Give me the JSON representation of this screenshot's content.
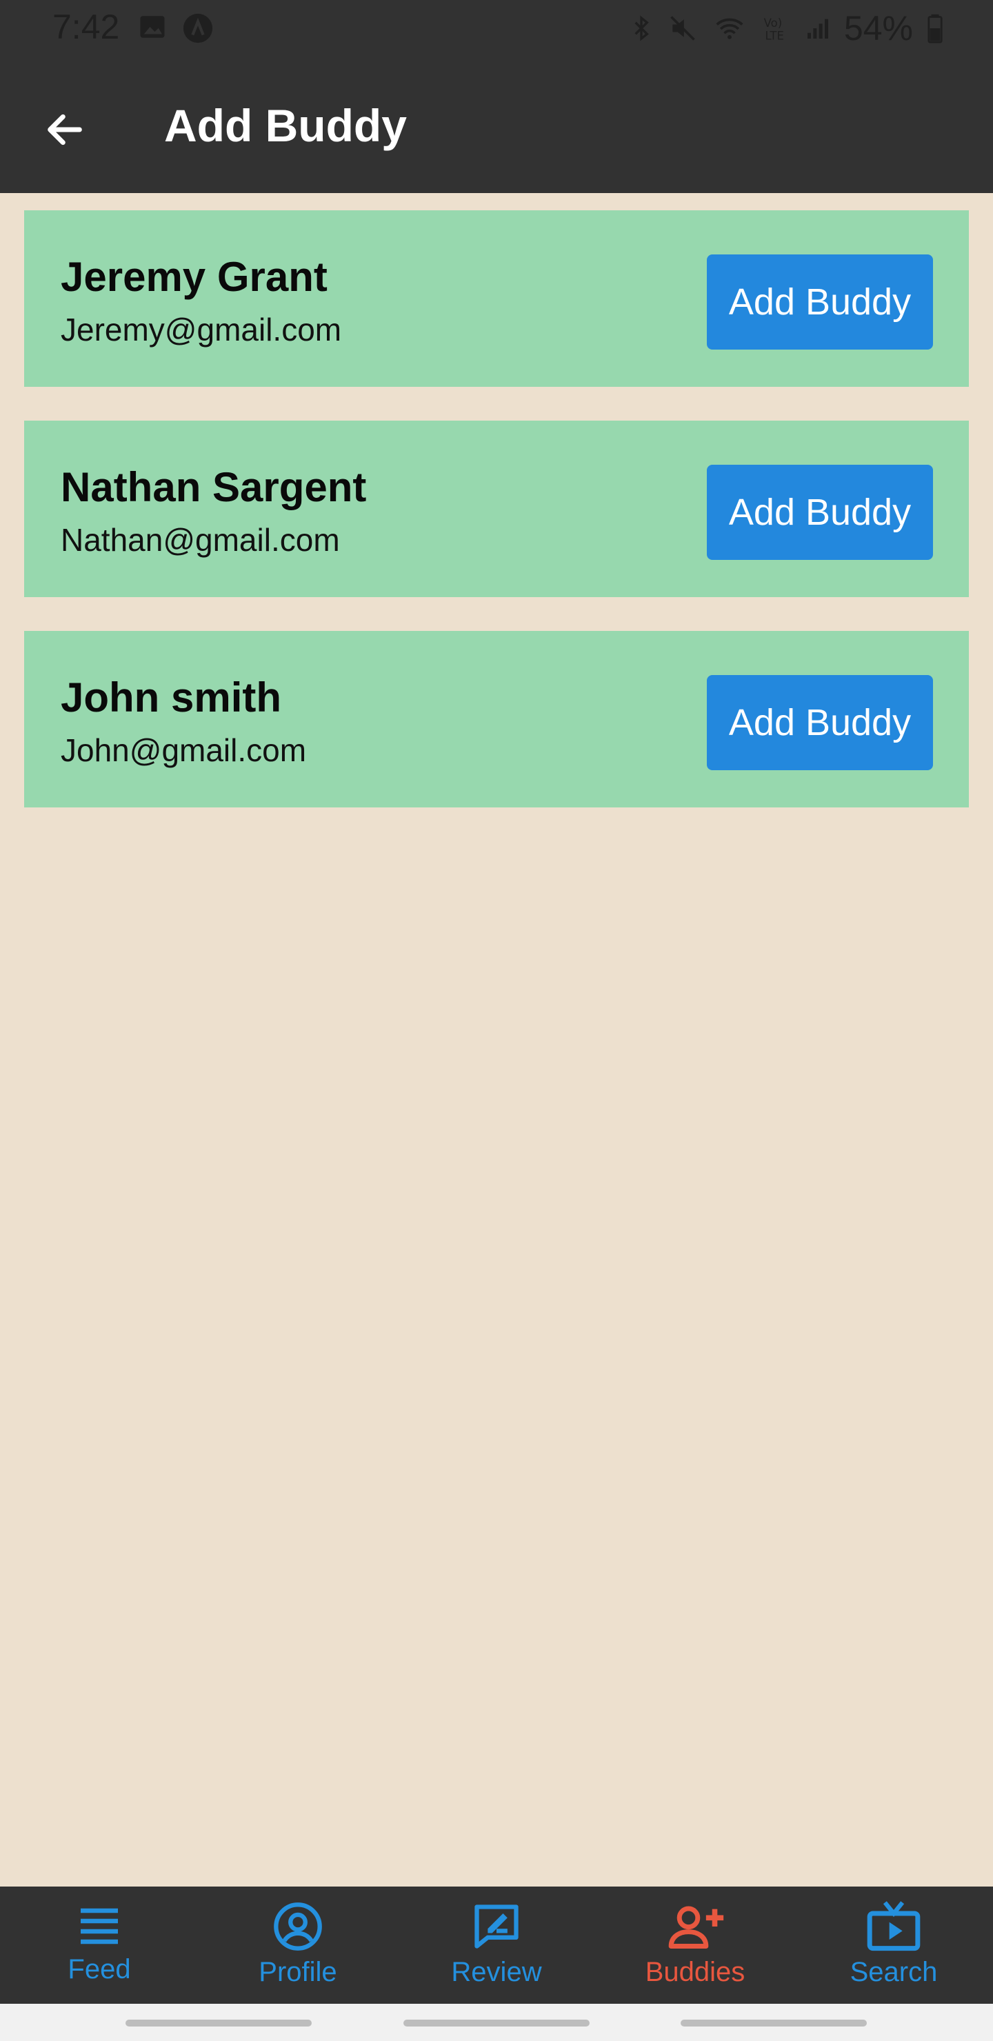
{
  "status": {
    "time": "7:42",
    "battery": "54%"
  },
  "appbar": {
    "title": "Add Buddy"
  },
  "buddies": [
    {
      "name": "Jeremy Grant",
      "email": "Jeremy@gmail.com",
      "button": "Add Buddy"
    },
    {
      "name": "Nathan Sargent",
      "email": "Nathan@gmail.com",
      "button": "Add Buddy"
    },
    {
      "name": "John smith",
      "email": "John@gmail.com",
      "button": "Add Buddy"
    }
  ],
  "nav": {
    "items": [
      {
        "label": "Feed",
        "icon": "list-icon",
        "active": false
      },
      {
        "label": "Profile",
        "icon": "user-circle-icon",
        "active": false
      },
      {
        "label": "Review",
        "icon": "review-icon",
        "active": false
      },
      {
        "label": "Buddies",
        "icon": "add-user-icon",
        "active": true
      },
      {
        "label": "Search",
        "icon": "tv-search-icon",
        "active": false
      }
    ],
    "active_color": "#E8573F",
    "inactive_color": "#2490DE"
  },
  "colors": {
    "background": "#EDE0CE",
    "bar": "#323232",
    "card": "#97D8AE",
    "button": "#2388DD"
  }
}
